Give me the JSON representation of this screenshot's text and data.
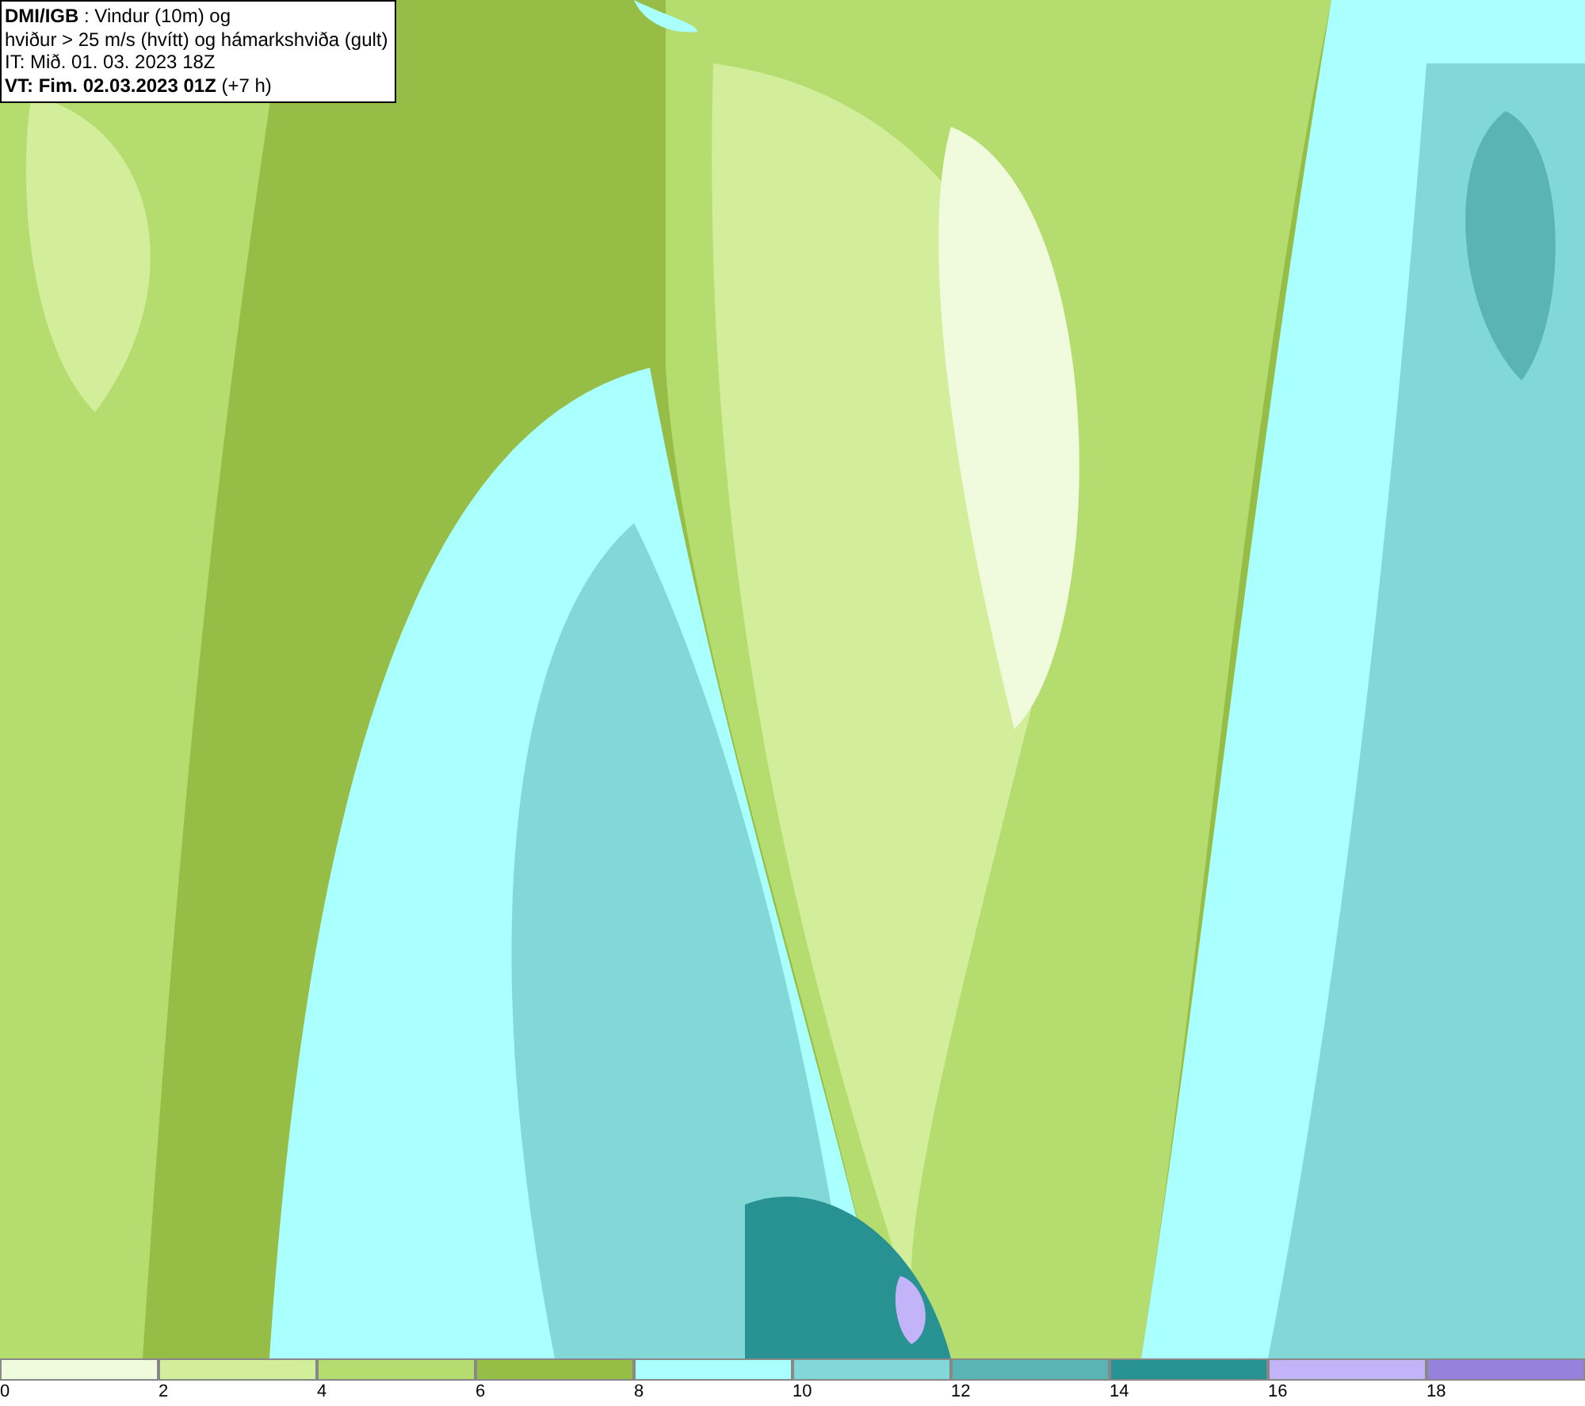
{
  "header": {
    "lines": [
      "**DMI/IGB** : Vindur (10m) og",
      "hviður > 25 m/s (hvítt) og hámarkshviða (gult)",
      "IT: Mið. 01. 03. 2023 18Z",
      "**VT: Fim. 02.03.2023 01Z** (+7 h)"
    ]
  },
  "legend": [
    {
      "label": "0",
      "color": "#f0fadc"
    },
    {
      "label": "2",
      "color": "#d2ee9a"
    },
    {
      "label": "4",
      "color": "#b4dc6e"
    },
    {
      "label": "6",
      "color": "#96be46"
    },
    {
      "label": "8",
      "color": "#aaffff"
    },
    {
      "label": "10",
      "color": "#82d7d7"
    },
    {
      "label": "12",
      "color": "#5ab4b4"
    },
    {
      "label": "14",
      "color": "#289191"
    },
    {
      "label": "16",
      "color": "#c3b4fa"
    },
    {
      "label": "18",
      "color": "#9682dc"
    }
  ]
}
